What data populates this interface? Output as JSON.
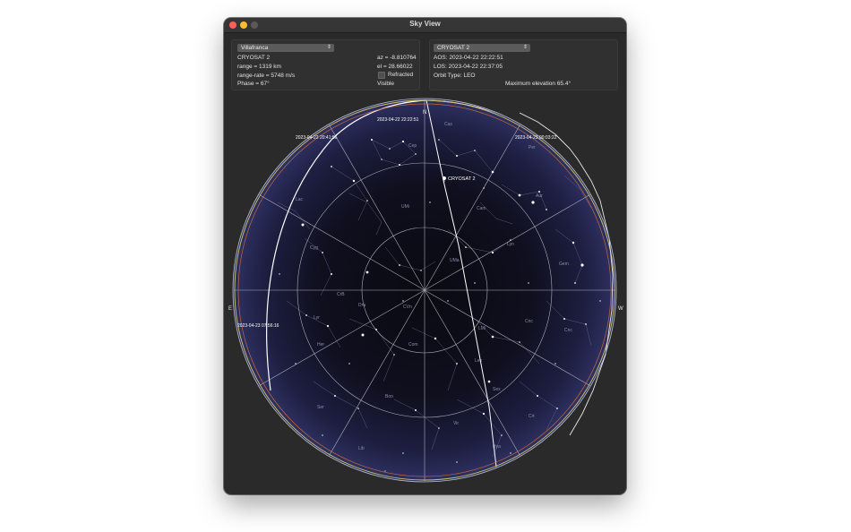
{
  "window": {
    "title": "Sky View"
  },
  "left_panel": {
    "location_select": "Villafranca",
    "satellite_name": "CRYOSAT 2",
    "range": "range = 1319 km",
    "range_rate": "range-rate = 5748 m/s",
    "phase": "Phase = 67°",
    "az": "az = -8.810764",
    "el": "el = 28.66022",
    "refracted_label": "Refracted",
    "refracted_checked": false,
    "visible": "Visible"
  },
  "right_panel": {
    "satellite_select": "CRYOSAT 2",
    "aos": "AOS:  2023-04-22 22:22:51",
    "los": "LOS:  2023-04-22 22:37:05",
    "orbit_type": "Orbit Type:  LEO",
    "max_elevation": "Maximum elevation   65.4°"
  },
  "sky": {
    "directions": {
      "north": "N",
      "south": "S",
      "east": "E",
      "west": "W"
    },
    "pass_labels": [
      "2023-04-22 22:22:51",
      "2023-04-22 20:41:56",
      "2023-04-23 00:03:22",
      "2023-04-23 07:56:16"
    ],
    "satellite_label": "CRYOSAT 2",
    "constellations": [
      "Cep",
      "Cas",
      "Per",
      "Lac",
      "Aur",
      "Lyn",
      "Cyg",
      "Cam",
      "UMi",
      "UMa",
      "Gem",
      "Cnc",
      "Lyr",
      "Dra",
      "Her",
      "CVn",
      "LMi",
      "Leo",
      "CrB",
      "Boo",
      "Com",
      "Ser",
      "Vir",
      "Sex",
      "Crt",
      "Hya",
      "Cnc",
      "Lib"
    ],
    "colors": {
      "sky_outer": "#2a2b55",
      "sky_center": "#0a0a12",
      "grid": "#cfcfd8",
      "horizon_yellow": "#c8c86a",
      "horizon_orange": "#c8663c"
    }
  }
}
